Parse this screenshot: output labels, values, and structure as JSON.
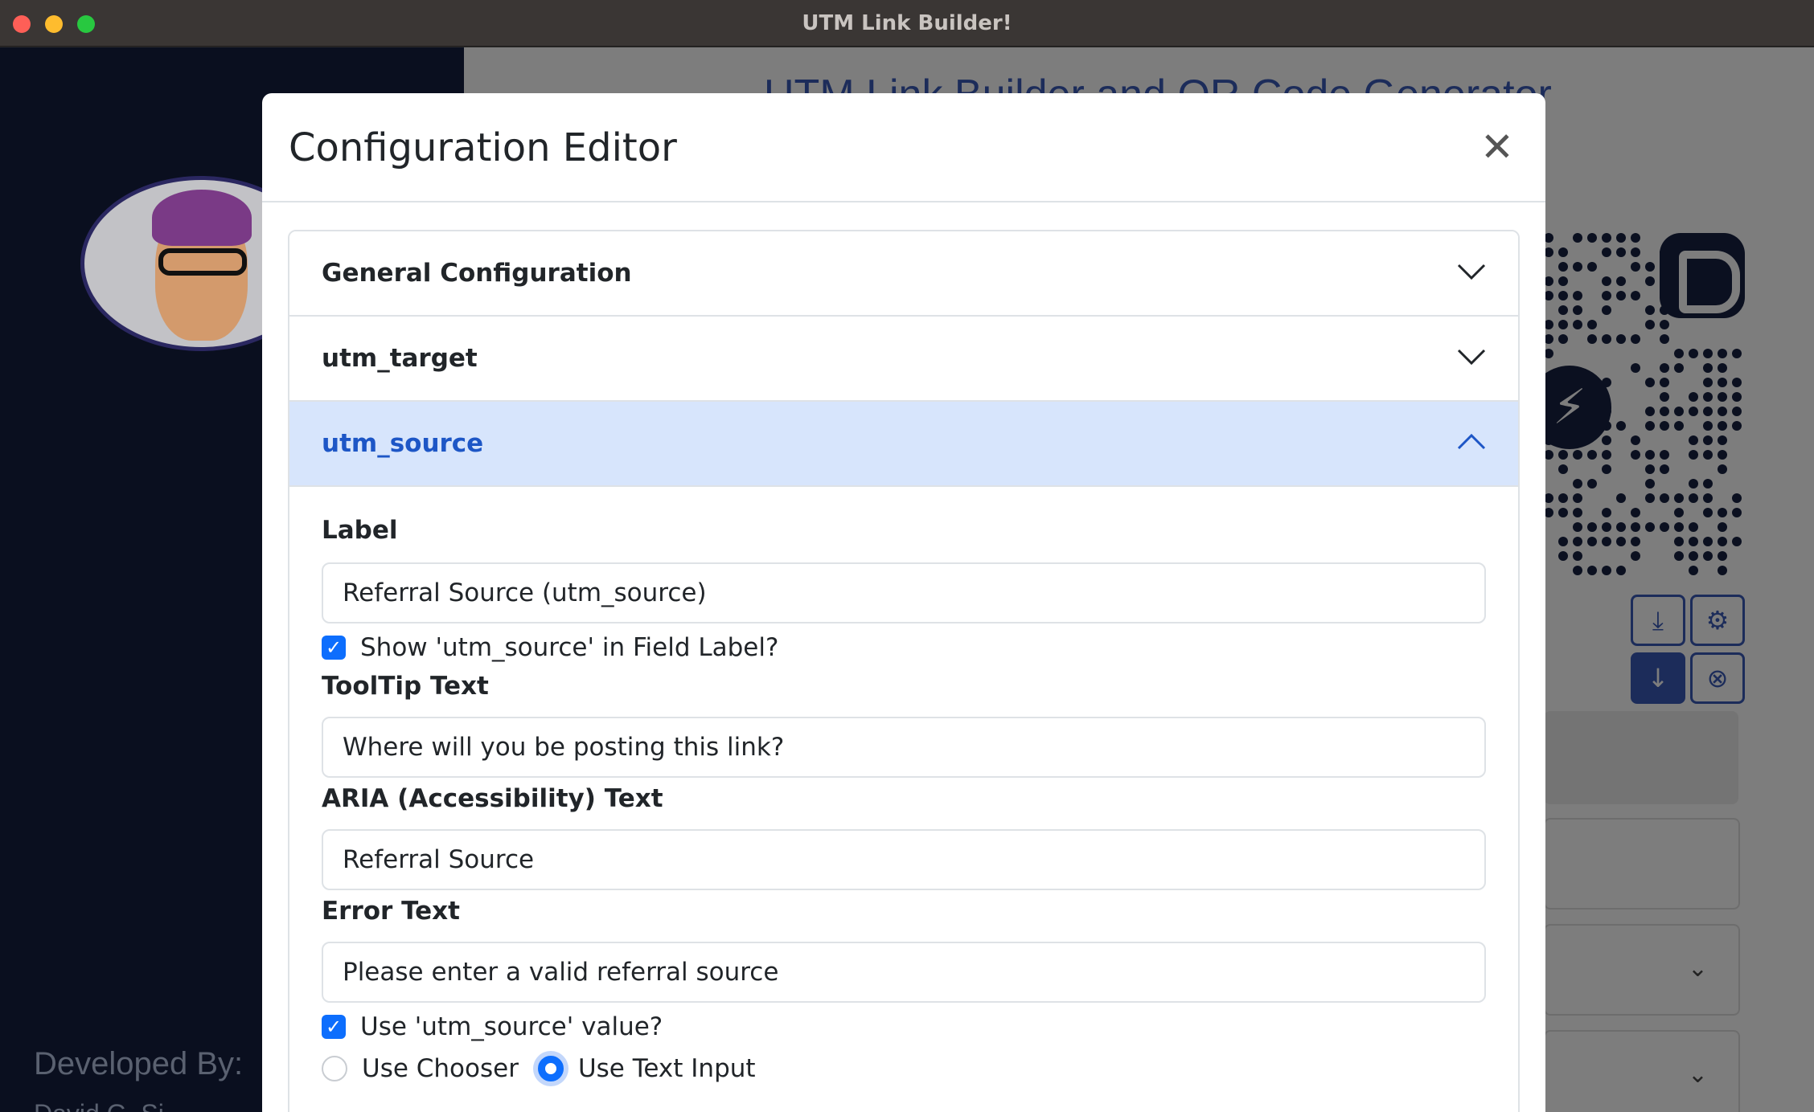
{
  "window": {
    "title": "UTM Link Builder!"
  },
  "background": {
    "heading": "UTM Link Builder and QR Code Generator",
    "developed_by": "Developed By:",
    "developer_name": "David G. Si"
  },
  "modal": {
    "title": "Configuration Editor",
    "close_icon": "close-icon",
    "sections": [
      {
        "label": "General Configuration",
        "expanded": false
      },
      {
        "label": "utm_target",
        "expanded": false
      },
      {
        "label": "utm_source",
        "expanded": true
      }
    ],
    "form": {
      "label_heading": "Label",
      "label_value": "Referral Source (utm_source)",
      "show_in_label": "Show 'utm_source' in Field Label?",
      "show_in_label_checked": true,
      "tooltip_heading": "ToolTip Text",
      "tooltip_value": "Where will you be posting this link?",
      "aria_heading": "ARIA (Accessibility) Text",
      "aria_value": "Referral Source",
      "error_heading": "Error Text",
      "error_value": "Please enter a valid referral source",
      "use_value": "Use 'utm_source' value?",
      "use_value_checked": true,
      "radio_chooser": "Use Chooser",
      "radio_text_input": "Use Text Input",
      "selected_input_type": "Use Text Input"
    }
  },
  "colors": {
    "accent": "#0d6efd",
    "active_header_bg": "#d7e5fc",
    "active_header_text": "#1d56c6",
    "sidebar_bg": "#0a0f1f"
  }
}
